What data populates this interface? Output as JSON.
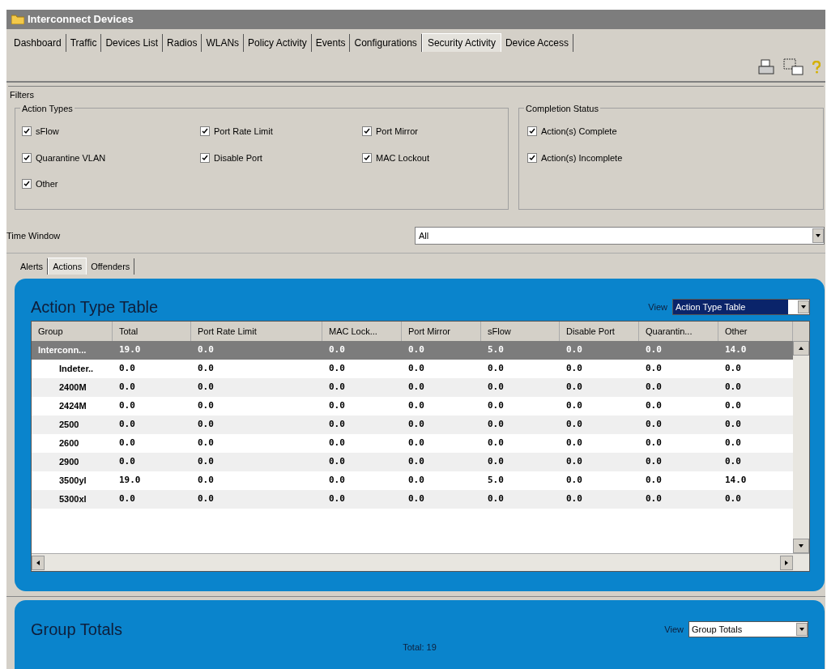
{
  "window": {
    "title": "Interconnect Devices"
  },
  "tabs": [
    {
      "label": "Dashboard",
      "selected": false
    },
    {
      "label": "Traffic",
      "selected": false
    },
    {
      "label": "Devices List",
      "selected": false
    },
    {
      "label": "Radios",
      "selected": false
    },
    {
      "label": "WLANs",
      "selected": false
    },
    {
      "label": "Policy Activity",
      "selected": false
    },
    {
      "label": "Events",
      "selected": false
    },
    {
      "label": "Configurations",
      "selected": false
    },
    {
      "label": "Security Activity",
      "selected": true
    },
    {
      "label": "Device Access",
      "selected": false
    }
  ],
  "filters": {
    "title": "Filters",
    "action_types": {
      "title": "Action Types",
      "items": [
        {
          "label": "sFlow",
          "checked": true
        },
        {
          "label": "Port Rate Limit",
          "checked": true
        },
        {
          "label": "Port Mirror",
          "checked": true
        },
        {
          "label": "Quarantine VLAN",
          "checked": true
        },
        {
          "label": "Disable Port",
          "checked": true
        },
        {
          "label": "MAC Lockout",
          "checked": true
        },
        {
          "label": "Other",
          "checked": true
        }
      ]
    },
    "completion_status": {
      "title": "Completion Status",
      "items": [
        {
          "label": "Action(s) Complete",
          "checked": true
        },
        {
          "label": "Action(s) Incomplete",
          "checked": true
        }
      ]
    },
    "time_window": {
      "label": "Time Window",
      "value": "All"
    }
  },
  "subtabs": [
    {
      "label": "Alerts",
      "selected": false
    },
    {
      "label": "Actions",
      "selected": true
    },
    {
      "label": "Offenders",
      "selected": false
    }
  ],
  "action_table": {
    "title": "Action Type Table",
    "view_label": "View",
    "view_value": "Action Type Table",
    "columns": [
      "Group",
      "Total",
      "Port Rate Limit",
      "MAC Lock...",
      "Port Mirror",
      "sFlow",
      "Disable Port",
      "Quarantin...",
      "Other"
    ],
    "rows": [
      {
        "group": "Interconn...",
        "selected": true,
        "values": [
          "19.0",
          "0.0",
          "0.0",
          "0.0",
          "5.0",
          "0.0",
          "0.0",
          "14.0"
        ],
        "children": [
          {
            "group": "Indeter..",
            "selected": false,
            "values": [
              "0.0",
              "0.0",
              "0.0",
              "0.0",
              "0.0",
              "0.0",
              "0.0",
              "0.0"
            ]
          },
          {
            "group": "2400M",
            "selected": false,
            "values": [
              "0.0",
              "0.0",
              "0.0",
              "0.0",
              "0.0",
              "0.0",
              "0.0",
              "0.0"
            ]
          },
          {
            "group": "2424M",
            "selected": false,
            "values": [
              "0.0",
              "0.0",
              "0.0",
              "0.0",
              "0.0",
              "0.0",
              "0.0",
              "0.0"
            ]
          },
          {
            "group": "2500",
            "selected": false,
            "values": [
              "0.0",
              "0.0",
              "0.0",
              "0.0",
              "0.0",
              "0.0",
              "0.0",
              "0.0"
            ]
          },
          {
            "group": "2600",
            "selected": false,
            "values": [
              "0.0",
              "0.0",
              "0.0",
              "0.0",
              "0.0",
              "0.0",
              "0.0",
              "0.0"
            ]
          },
          {
            "group": "2900",
            "selected": false,
            "values": [
              "0.0",
              "0.0",
              "0.0",
              "0.0",
              "0.0",
              "0.0",
              "0.0",
              "0.0"
            ]
          },
          {
            "group": "3500yl",
            "selected": false,
            "values": [
              "19.0",
              "0.0",
              "0.0",
              "0.0",
              "5.0",
              "0.0",
              "0.0",
              "14.0"
            ]
          },
          {
            "group": "5300xl",
            "selected": false,
            "values": [
              "0.0",
              "0.0",
              "0.0",
              "0.0",
              "0.0",
              "0.0",
              "0.0",
              "0.0"
            ]
          }
        ]
      }
    ]
  },
  "group_totals": {
    "title": "Group Totals",
    "view_label": "View",
    "view_value": "Group Totals",
    "total": "Total: 19"
  }
}
